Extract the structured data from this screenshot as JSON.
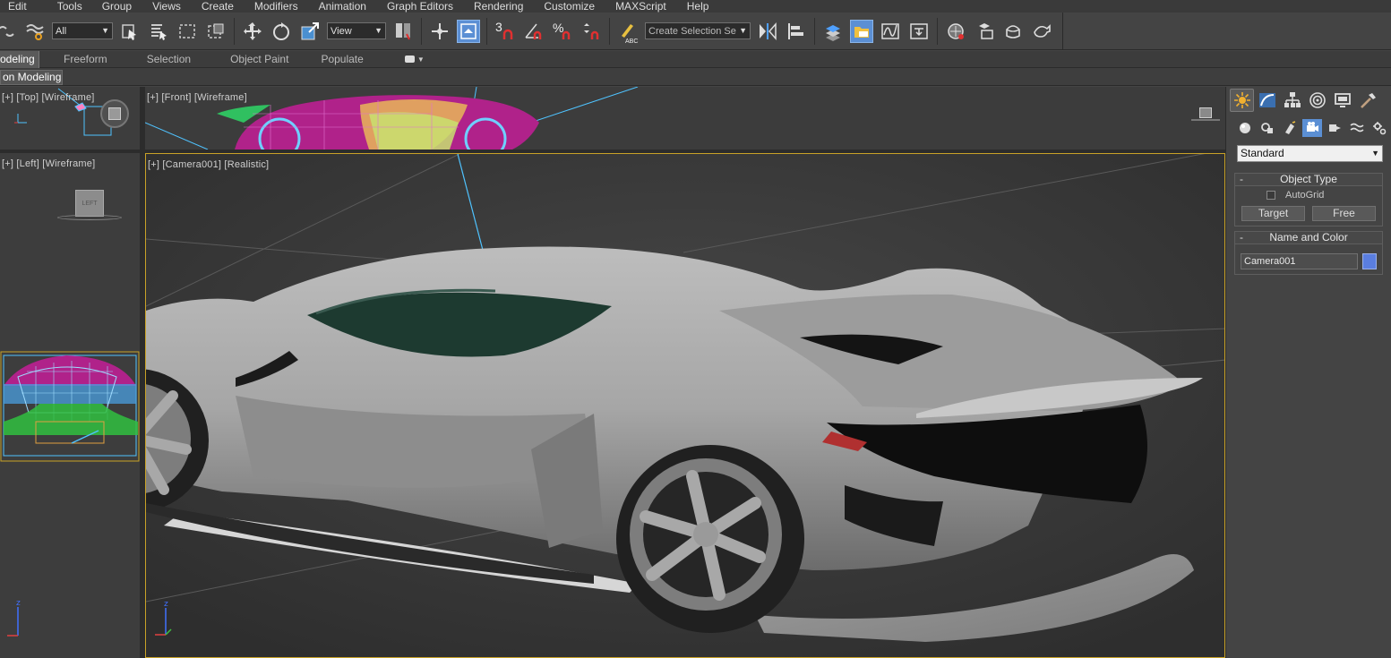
{
  "menu": [
    "Edit",
    "Tools",
    "Group",
    "Views",
    "Create",
    "Modifiers",
    "Animation",
    "Graph Editors",
    "Rendering",
    "Customize",
    "MAXScript",
    "Help"
  ],
  "toolbar": {
    "selection_filter": "All",
    "reference_coord": "View",
    "named_selection": "Create Selection Se",
    "snap_label": "3",
    "percent_snap": "%",
    "abc_label": "ABC"
  },
  "ribbon": {
    "tabs": [
      "odeling",
      "Freeform",
      "Selection",
      "Object Paint",
      "Populate"
    ],
    "active_index": 0,
    "sub_tab": "on Modeling"
  },
  "viewports": {
    "top": "[+] [Top] [Wireframe]",
    "front": "[+] [Front] [Wireframe]",
    "left": "[+] [Left] [Wireframe]",
    "camera": "[+] [Camera001] [Realistic]",
    "left_cube_face": "LEFT",
    "axis_x": "x",
    "axis_z": "z",
    "axis_y": "y"
  },
  "command_panel": {
    "category": "Standard",
    "object_type": {
      "title": "Object Type",
      "autogrid_label": "AutoGrid",
      "autogrid_checked": false,
      "buttons": [
        "Target",
        "Free"
      ]
    },
    "name_and_color": {
      "title": "Name and Color",
      "name_value": "Camera001",
      "color": "#5a7ee0"
    }
  },
  "colors": {
    "accent": "#5b8fd4",
    "active_viewport_border": "#c9a227",
    "camera_line": "#4fc3ff"
  }
}
